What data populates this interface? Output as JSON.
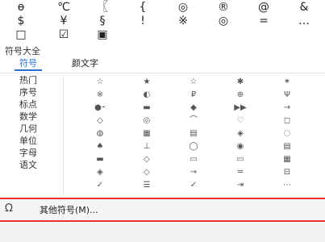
{
  "top_symbols": [
    [
      "ɵ",
      "℃",
      "〖",
      "{",
      "◎",
      "®",
      "@",
      "&"
    ],
    [
      "$",
      "¥",
      "§",
      "!",
      "※",
      "◎",
      "=",
      "…"
    ],
    [
      "□",
      "☑",
      "▣"
    ]
  ],
  "panel": {
    "title": "符号大全",
    "tabs": [
      "符号",
      "颜文字"
    ]
  },
  "categories": [
    "热门",
    "序号",
    "标点",
    "数学",
    "几何",
    "单位",
    "字母",
    "语文"
  ],
  "symbol_grid": [
    [
      "☆",
      "★",
      "☆",
      "✱",
      "✶"
    ],
    [
      "※",
      "◐",
      "₽",
      "⊕",
      "Ψ"
    ],
    [
      "●⁃",
      "▬",
      "◆",
      "▶▶",
      "→"
    ],
    [
      "◇",
      "◎",
      "⌒",
      "♡",
      "◻"
    ],
    [
      "◍",
      "▦",
      "▤",
      "◈",
      "◌"
    ],
    [
      "♠",
      "⊥",
      "◯",
      "◉",
      "▤"
    ],
    [
      "▬",
      "◇",
      "▭",
      "▭",
      "▦"
    ],
    [
      "◈",
      "◇",
      "→",
      "═",
      "⊟"
    ],
    [
      "✓",
      "☰",
      "✓",
      "⇥",
      "⋯"
    ]
  ],
  "more": {
    "icon": "omega-icon",
    "label": "其他符号(M)..."
  },
  "colors": {
    "accent": "#2b6fd6",
    "highlight": "#e8312b"
  }
}
